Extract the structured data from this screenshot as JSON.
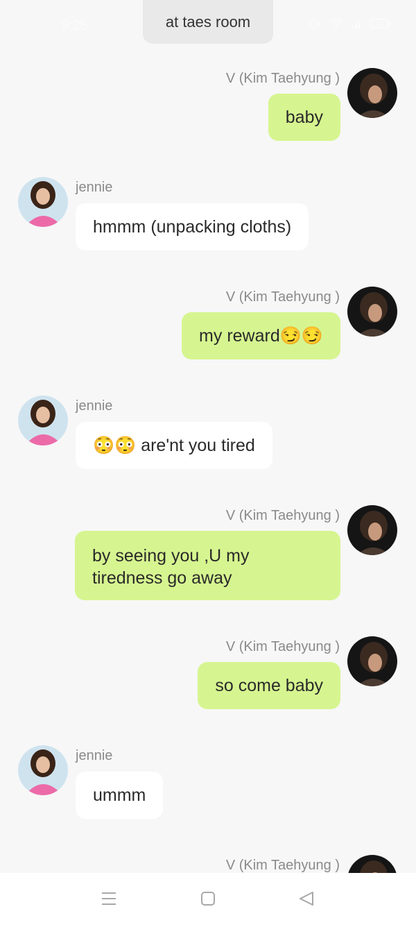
{
  "status_bar": {
    "time": "9:25",
    "battery": "73"
  },
  "chat": {
    "title": "at taes room"
  },
  "messages": [
    {
      "sender": "V (Kim Taehyung )",
      "text": "baby",
      "direction": "out"
    },
    {
      "sender": "jennie",
      "text": "hmmm (unpacking cloths)",
      "direction": "in"
    },
    {
      "sender": "V (Kim Taehyung )",
      "text": "my reward😏😏",
      "direction": "out"
    },
    {
      "sender": "jennie",
      "text": "😳😳 are'nt you tired",
      "direction": "in"
    },
    {
      "sender": "V (Kim Taehyung )",
      "text": "by seeing you ,U my tiredness go away",
      "direction": "out"
    },
    {
      "sender": "V (Kim Taehyung )",
      "text": "so come baby",
      "direction": "out"
    },
    {
      "sender": "jennie",
      "text": "ummm",
      "direction": "in"
    },
    {
      "sender": "V (Kim Taehyung )",
      "text": "",
      "direction": "out"
    }
  ],
  "colors": {
    "outgoing_bubble": "#d6f590",
    "incoming_bubble": "#ffffff",
    "background": "#f7f7f7"
  },
  "nav": {
    "icons": [
      "menu-icon",
      "home-square-icon",
      "back-triangle-icon"
    ]
  }
}
